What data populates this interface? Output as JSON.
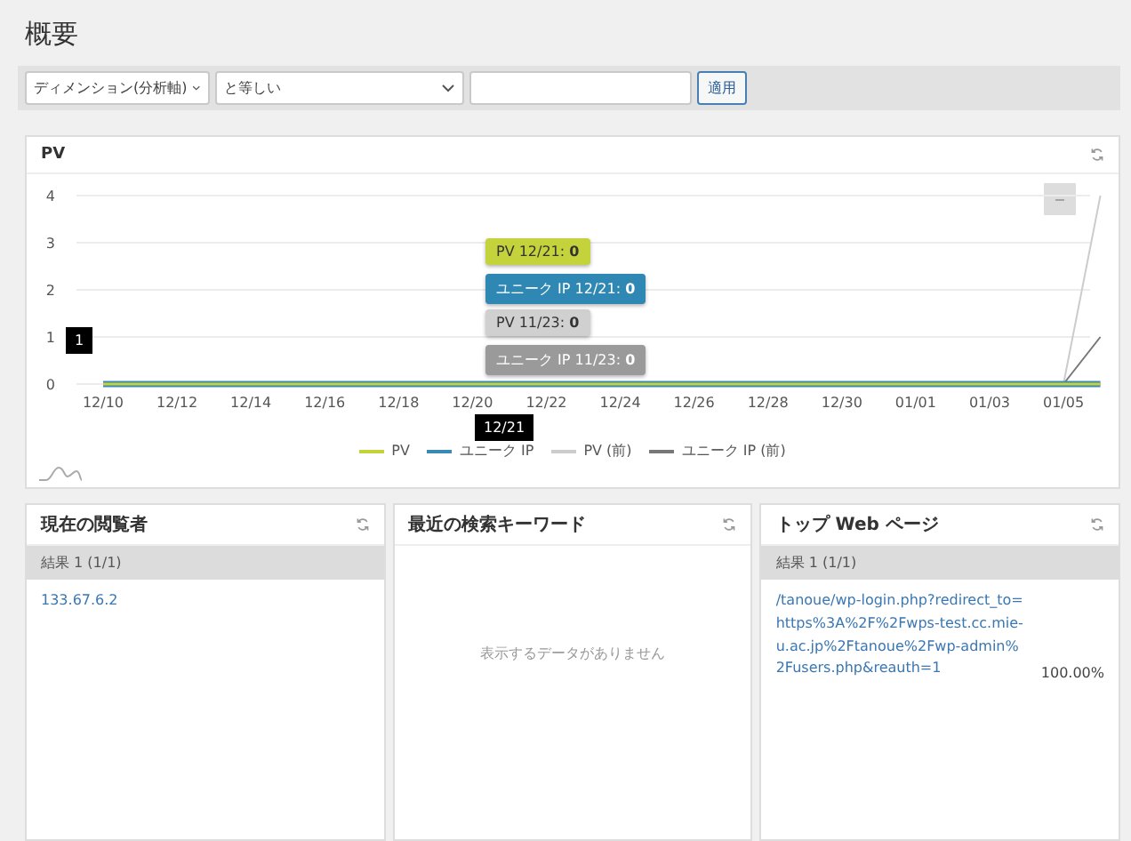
{
  "page_title": "概要",
  "filter": {
    "dimension": "ディメンション(分析軸)",
    "operator": "と等しい",
    "apply_button": "適用"
  },
  "pv_panel": {
    "title": "PV",
    "chart_data": {
      "type": "line",
      "grid": true,
      "categories": [
        "12/10",
        null,
        "12/12",
        null,
        "12/14",
        null,
        "12/16",
        null,
        "12/18",
        null,
        "12/20",
        null,
        "12/22",
        null,
        "12/24",
        null,
        "12/26",
        null,
        "12/28",
        null,
        "12/30",
        null,
        "01/01",
        null,
        "01/03",
        null,
        "01/05",
        null
      ],
      "yticks": [
        0,
        1,
        2,
        3,
        4
      ],
      "ylim": [
        0,
        4
      ],
      "series": [
        {
          "name": "PV",
          "color": "#c4d33b",
          "values": [
            0,
            0,
            0,
            0,
            0,
            0,
            0,
            0,
            0,
            0,
            0,
            0,
            0,
            0,
            0,
            0,
            0,
            0,
            0,
            0,
            0,
            0,
            0,
            0,
            0,
            0,
            0,
            0
          ]
        },
        {
          "name": "ユニーク IP",
          "color": "#3a8ab5",
          "values": [
            0,
            0,
            0,
            0,
            0,
            0,
            0,
            0,
            0,
            0,
            0,
            0,
            0,
            0,
            0,
            0,
            0,
            0,
            0,
            0,
            0,
            0,
            0,
            0,
            0,
            0,
            0,
            0
          ]
        },
        {
          "name": "PV (前)",
          "color": "#cccccc",
          "values": [
            null,
            null,
            null,
            null,
            null,
            null,
            null,
            null,
            null,
            null,
            null,
            null,
            null,
            null,
            null,
            null,
            null,
            null,
            null,
            null,
            null,
            null,
            null,
            null,
            null,
            null,
            0,
            4
          ]
        },
        {
          "name": "ユニーク IP (前)",
          "color": "#777777",
          "values": [
            null,
            null,
            null,
            null,
            null,
            null,
            null,
            null,
            null,
            null,
            null,
            null,
            null,
            null,
            null,
            null,
            null,
            null,
            null,
            null,
            null,
            null,
            null,
            null,
            null,
            null,
            0,
            1
          ]
        }
      ]
    },
    "tooltips": [
      {
        "label": "PV 12/21: **0**",
        "color": "#c4d33b"
      },
      {
        "label": "ユニーク IP 12/21: **0**",
        "color": "#2f87b3"
      },
      {
        "label": "PV 11/23: **0**",
        "color": "#d0d0d0"
      },
      {
        "label": "ユニーク IP 11/23: **0**",
        "color": "#9a9a9a"
      }
    ],
    "y_marker": "1",
    "x_marker": "12/21",
    "zoom_button": "−"
  },
  "panels": [
    {
      "title": "現在の閲覧者",
      "kind": "list",
      "result": "結果 1 (1/1)",
      "rows": [
        {
          "text": "133.67.6.2"
        }
      ]
    },
    {
      "title": "最近の検索キーワード",
      "kind": "empty",
      "empty_message": "表示するデータがありません"
    },
    {
      "title": "トップ Web ページ",
      "kind": "list",
      "result": "結果 1 (1/1)",
      "rows": [
        {
          "text": "/tanoue/wp-login.php?redirect_to=https%3A%2F%2Fwps-test.cc.mie-u.ac.jp%2Ftanoue%2Fwp-admin%2Fusers.php&reauth=1",
          "value": "100.00%"
        }
      ]
    }
  ]
}
